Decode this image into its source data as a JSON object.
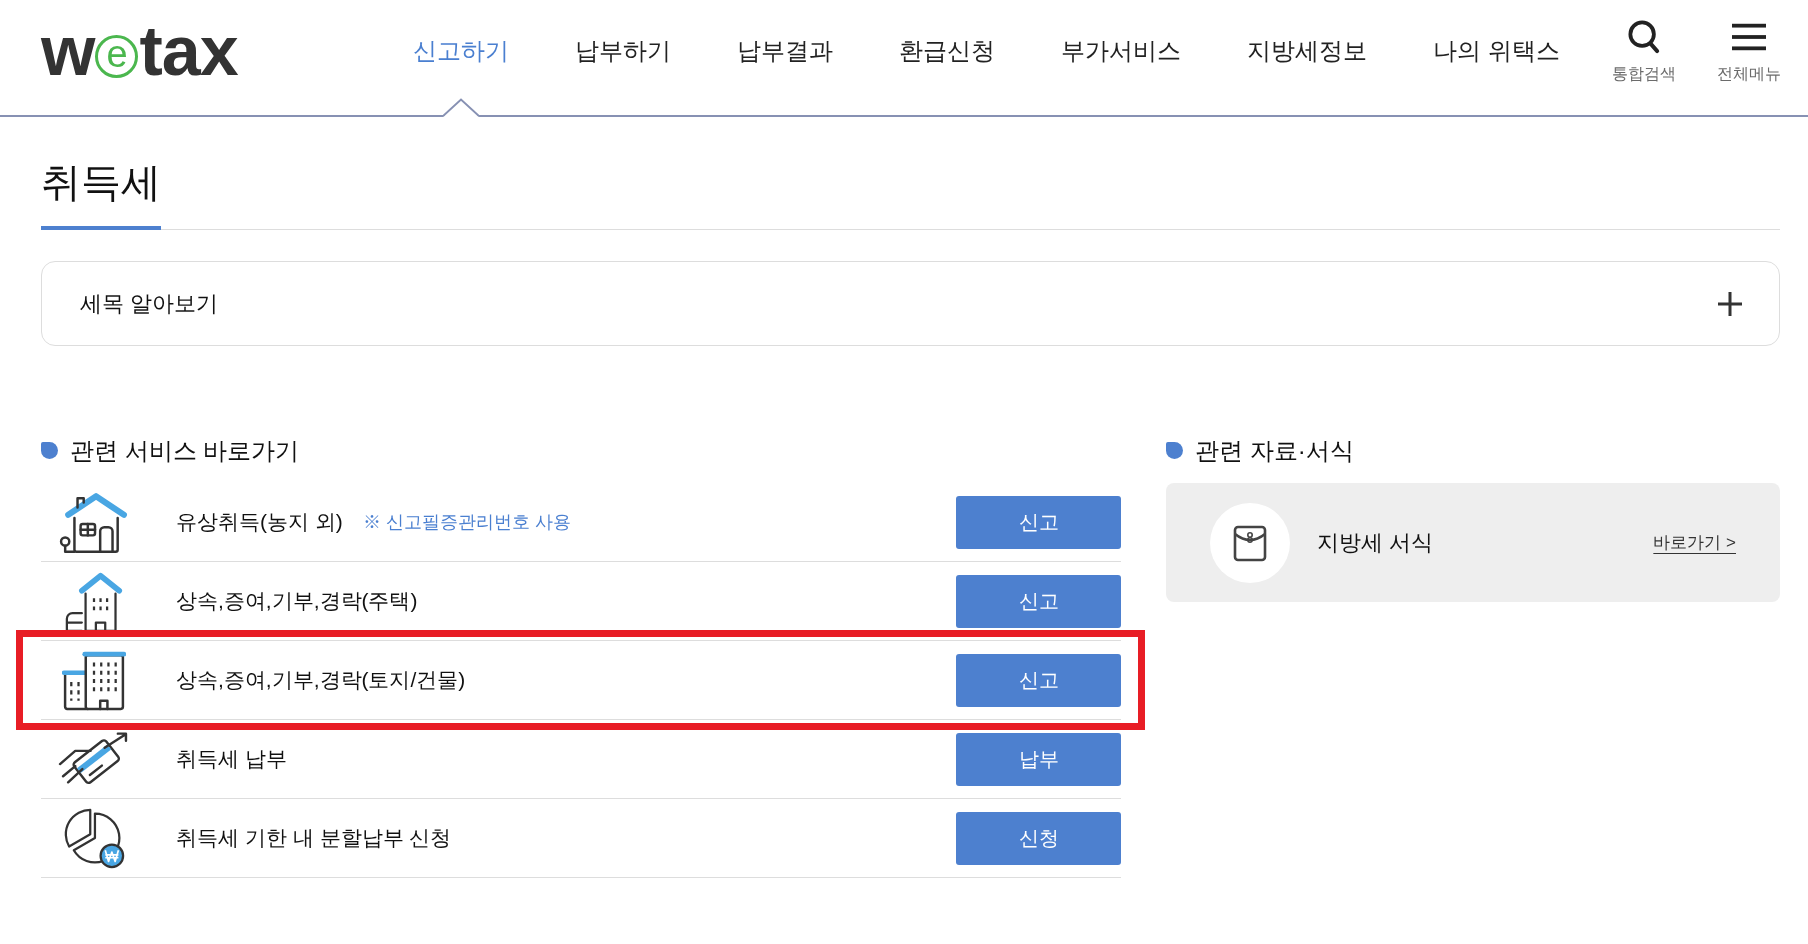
{
  "header": {
    "logo": {
      "lead": "w",
      "ring": "e",
      "tail": "tax"
    },
    "nav": [
      {
        "label": "신고하기",
        "selected": true
      },
      {
        "label": "납부하기",
        "selected": false
      },
      {
        "label": "납부결과",
        "selected": false
      },
      {
        "label": "환급신청",
        "selected": false
      },
      {
        "label": "부가서비스",
        "selected": false
      },
      {
        "label": "지방세정보",
        "selected": false
      },
      {
        "label": "나의 위택스",
        "selected": false
      }
    ],
    "tools": [
      {
        "kind": "search",
        "label": "통합검색"
      },
      {
        "kind": "menu",
        "label": "전체메뉴"
      }
    ]
  },
  "page_title": "취득세",
  "accordion": {
    "label": "세목 알아보기",
    "expanded": false
  },
  "services": {
    "heading": "관련 서비스 바로가기",
    "items": [
      {
        "kind": "house",
        "title": "유상취득(농지 외)",
        "note": "※ 신고필증관리번호 사용",
        "button": "신고",
        "highlighted": false
      },
      {
        "kind": "house_annex",
        "title": "상속,증여,기부,경락(주택)",
        "button": "신고",
        "highlighted": false
      },
      {
        "kind": "buildings",
        "title": "상속,증여,기부,경락(토지/건물)",
        "button": "신고",
        "highlighted": true
      },
      {
        "kind": "card",
        "title": "취득세 납부",
        "button": "납부",
        "highlighted": false
      },
      {
        "kind": "installment",
        "title": "취득세 기한 내 분할납부 신청",
        "button": "신청",
        "highlighted": false
      }
    ]
  },
  "resources": {
    "heading": "관련 자료·서식",
    "items": [
      {
        "kind": "envelope",
        "title": "지방세 서식",
        "link": "바로가기 >"
      }
    ]
  }
}
